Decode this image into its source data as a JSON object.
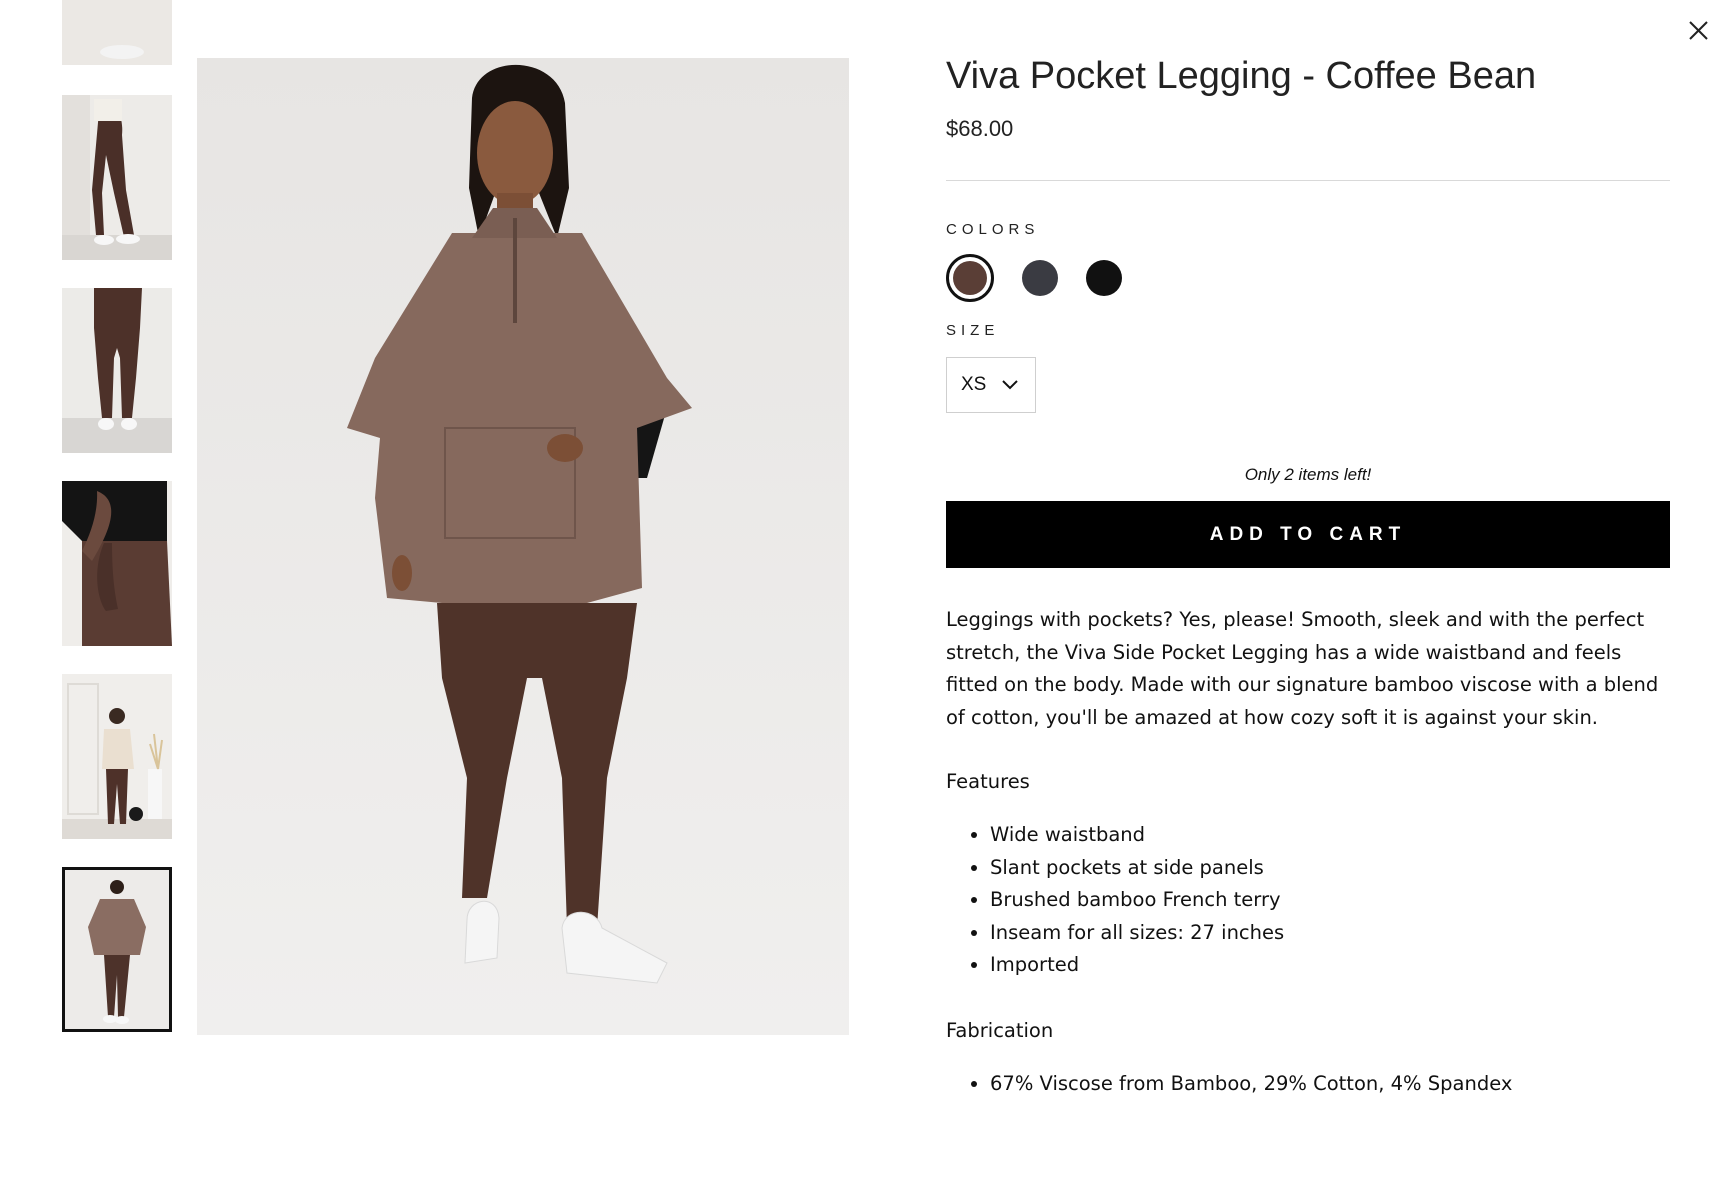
{
  "product": {
    "title": "Viva Pocket Legging - Coffee Bean",
    "price": "$68.00",
    "colors_label": "COLORS",
    "colors": [
      {
        "name": "Coffee Bean",
        "hex": "#5a3e36",
        "selected": true
      },
      {
        "name": "Charcoal",
        "hex": "#3a3b42",
        "selected": false
      },
      {
        "name": "Black",
        "hex": "#111111",
        "selected": false
      }
    ],
    "size_label": "SIZE",
    "size_selected": "XS",
    "stock_note": "Only 2 items left!",
    "add_to_cart": "ADD TO CART",
    "description": "Leggings with pockets? Yes, please! Smooth, sleek and with the perfect stretch, the Viva Side Pocket Legging has a wide waistband and feels fitted on the body. Made with our signature bamboo viscose with a blend of cotton, you'll be amazed at how cozy soft it is against your skin.",
    "features_heading": "Features",
    "features": [
      "Wide waistband",
      "Slant pockets at side panels",
      "Brushed bamboo French terry",
      "Inseam for all sizes: 27 inches",
      "Imported"
    ],
    "fabrication_heading": "Fabrication",
    "fabrication": [
      "67% Viscose from Bamboo, 29% Cotton, 4% Spandex"
    ]
  },
  "gallery": {
    "selected_index": 5,
    "thumbnail_count": 6
  },
  "icons": {
    "close": "close-icon",
    "dropdown": "chevron-down-icon"
  }
}
